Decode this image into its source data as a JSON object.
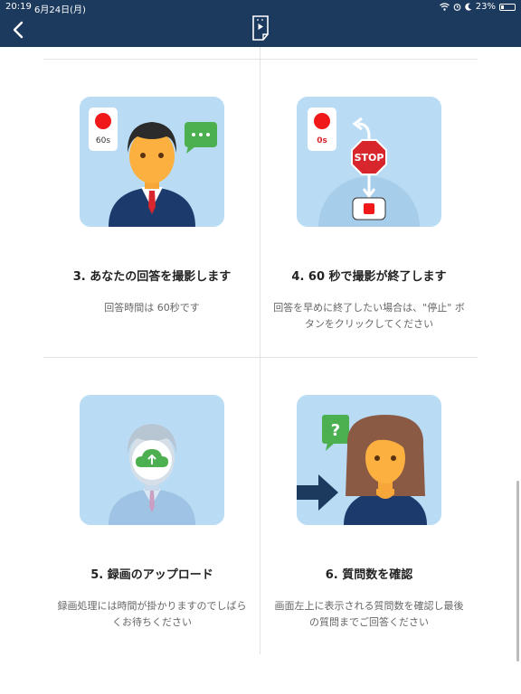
{
  "status_bar": {
    "time": "20:19",
    "date": "6月24日(月)",
    "battery": "23%",
    "battery_level": 0.23
  },
  "colors": {
    "header_bg": "#1c3a5e",
    "record_red": "#f01818",
    "stop_red": "#d7262c",
    "chat_green": "#4caf50",
    "illus_bg": "#b9dcf4"
  },
  "cards": [
    {
      "title": "3. あなたの回答を撮影します",
      "desc": "回答時間は 60秒です",
      "badge": "60s"
    },
    {
      "title": "4. 60 秒で撮影が終了します",
      "desc": "回答を早めに終了したい場合は、\"停止\" ボタンをクリックしてください",
      "badge": "0s",
      "stop_text": "STOP"
    },
    {
      "title": "5. 録画のアップロード",
      "desc": "録画処理には時間が掛かりますのでしばらくお待ちください"
    },
    {
      "title": "6. 質問数を確認",
      "desc": "画面左上に表示される質問数を確認し最後の質問までご回答ください",
      "question_mark": "?"
    }
  ]
}
